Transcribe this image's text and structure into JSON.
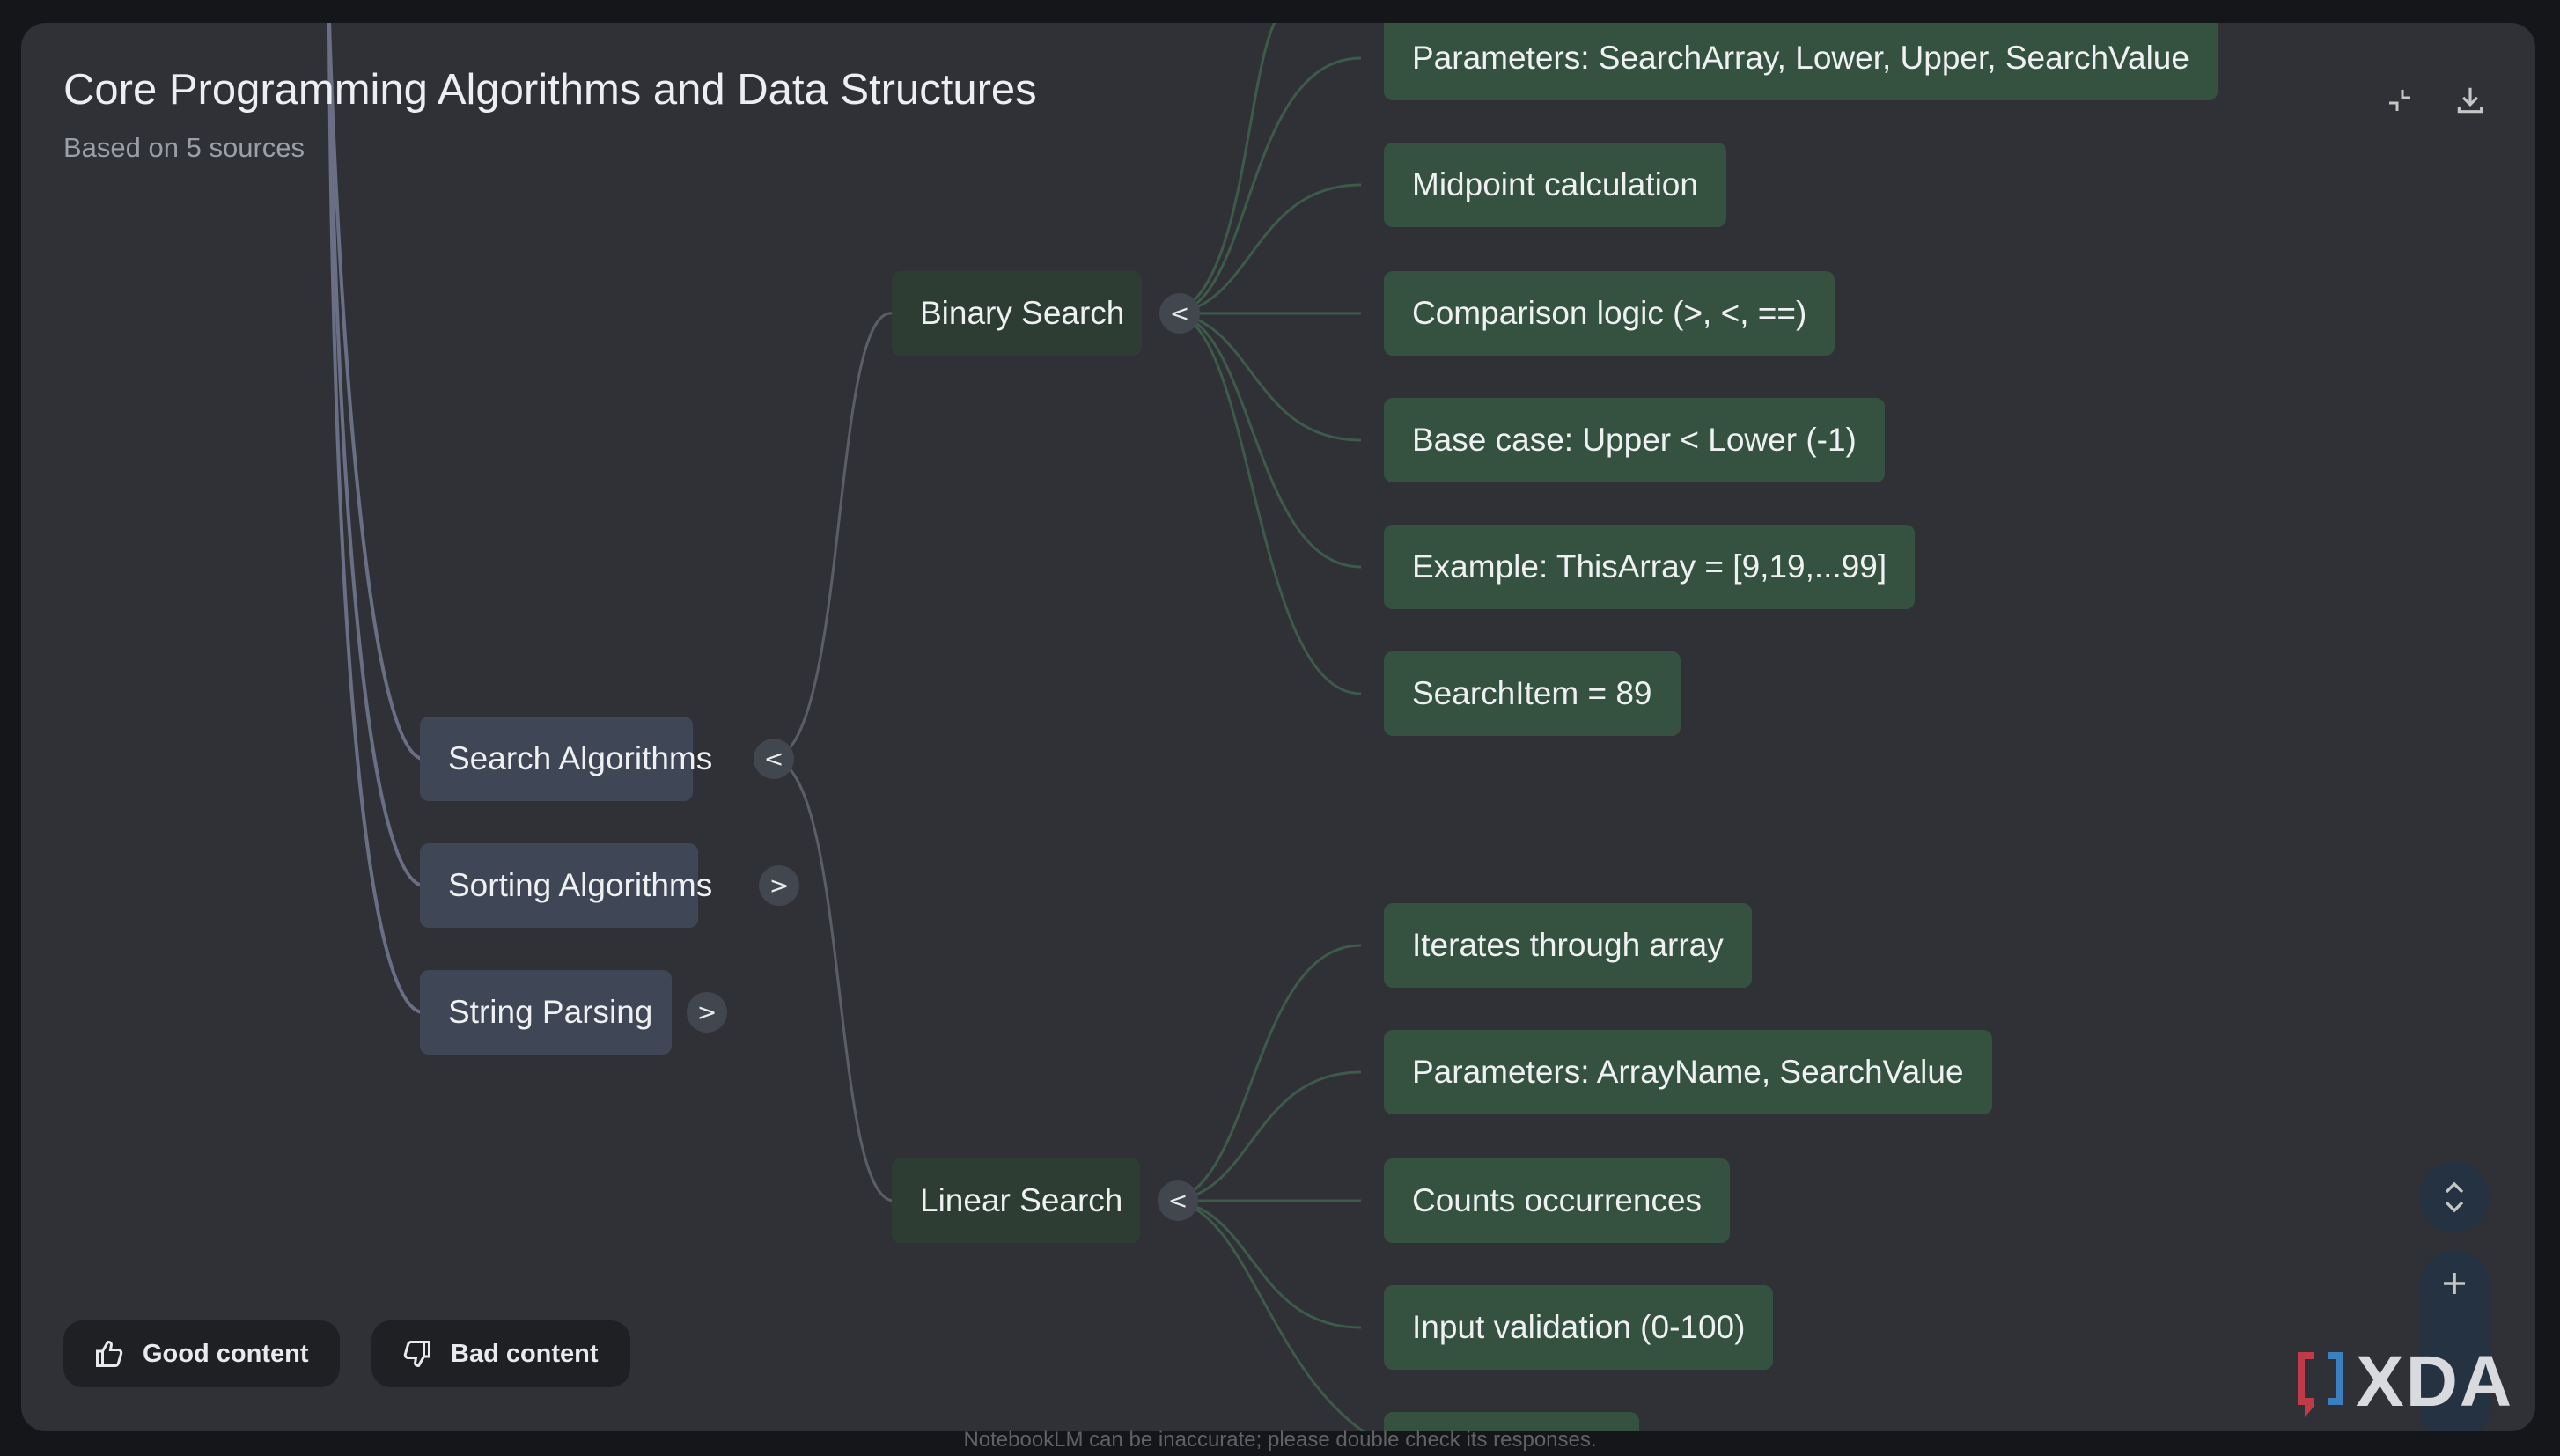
{
  "header": {
    "title": "Core Programming Algorithms and Data Structures",
    "subtitle": "Based on 5 sources"
  },
  "toolbar": {
    "collapse_icon": "collapse-icon",
    "download_icon": "download-icon"
  },
  "mindmap": {
    "roots": [
      {
        "label": "Search Algorithms",
        "toggle": "<"
      },
      {
        "label": "Sorting Algorithms",
        "toggle": ">"
      },
      {
        "label": "String Parsing",
        "toggle": ">"
      }
    ],
    "binary_search": {
      "label": "Binary Search",
      "toggle": "<",
      "children": [
        "Parameters: SearchArray, Lower, Upper, SearchValue",
        "Midpoint calculation",
        "Comparison logic (>, <, ==)",
        "Base case: Upper < Lower (-1)",
        "Example: ThisArray = [9,19,...99]",
        "SearchItem = 89"
      ]
    },
    "linear_search": {
      "label": "Linear Search",
      "toggle": "<",
      "children": [
        "Iterates through array",
        "Parameters: ArrayName, SearchValue",
        "Counts occurrences",
        "Input validation (0-100)"
      ]
    }
  },
  "controls": {
    "expand_icon": "unfold-icon",
    "zoom_in_icon": "plus-icon",
    "zoom_out_icon": "minus-icon"
  },
  "feedback": {
    "good": "Good content",
    "bad": "Bad content"
  },
  "footer": {
    "disclaimer": "NotebookLM can be inaccurate; please double check its responses."
  },
  "watermark": {
    "text": "XDA"
  },
  "colors": {
    "background": "#151619",
    "panel": "#303136",
    "root_node": "#3f4756",
    "mid_node": "#2e3d34",
    "leaf_node": "#355240",
    "link_root": "#6a6f85",
    "link_green": "#3d5a4a"
  }
}
